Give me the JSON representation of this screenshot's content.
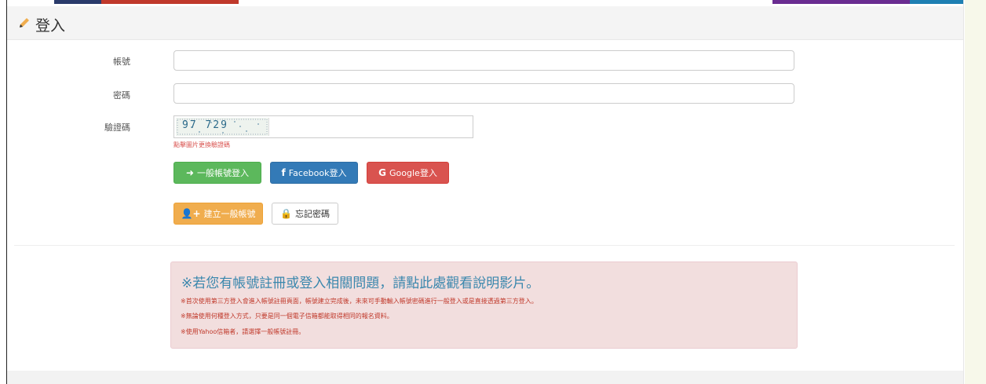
{
  "panel": {
    "title": "登入",
    "icon": "pencil-icon"
  },
  "form": {
    "account_label": "帳號",
    "account_value": "",
    "password_label": "密碼",
    "password_value": "",
    "captcha_label": "驗證碼",
    "captcha_image_text": "97 729",
    "captcha_value": "",
    "captcha_hint": "點擊圖片更換驗證碼"
  },
  "buttons": {
    "general_login": "一般帳號登入",
    "facebook_login": "Facebook登入",
    "google_login": "Google登入",
    "create_account": "建立一般帳號",
    "forgot_password": "忘記密碼"
  },
  "notice": {
    "title": "※若您有帳號註冊或登入相關問題，請點此處觀看說明影片。",
    "lines": [
      "※首次使用第三方登入會進入帳號註冊頁面，帳號建立完成後，未來可手動輸入帳號密碼進行一般登入或是直接透過第三方登入。",
      "※無論使用何種登入方式，只要是同一個電子信箱都能取得相同的報名資料。",
      "※使用Yahoo信箱者，請選擇一般帳號註冊。"
    ]
  },
  "colors": {
    "green": "#5cb85c",
    "blue": "#337ab7",
    "red": "#d9534f",
    "orange": "#f0ad4e",
    "alert_bg": "#f2dede",
    "alert_title": "#3a87ad"
  }
}
